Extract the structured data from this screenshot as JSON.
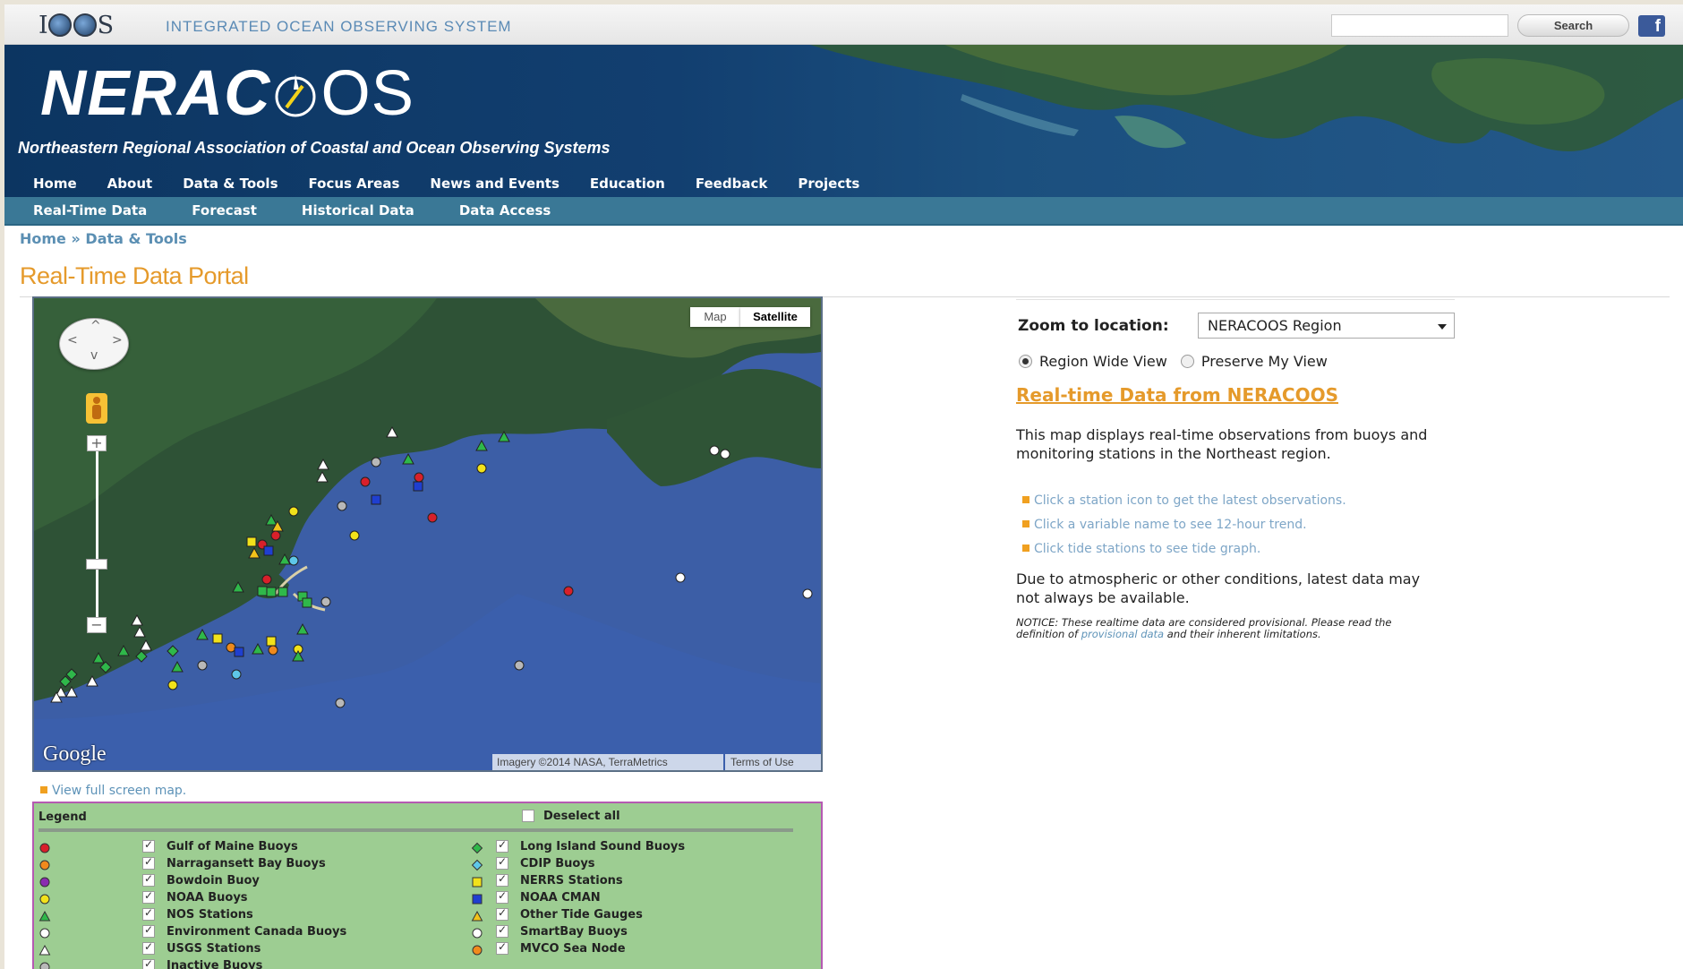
{
  "ioos": {
    "logo_text": "IOOS",
    "name": "Integrated Ocean Observing System",
    "search_value": "",
    "search_button": "Search",
    "facebook_glyph": "f"
  },
  "banner": {
    "title_bold": "NERAC",
    "title_thin": "OS",
    "subtitle": "Northeastern Regional Association of Coastal and Ocean Observing Systems"
  },
  "nav_primary": [
    "Home",
    "About",
    "Data & Tools",
    "Focus Areas",
    "News and Events",
    "Education",
    "Feedback",
    "Projects"
  ],
  "nav_secondary": [
    "Real-Time Data",
    "Forecast",
    "Historical Data",
    "Data Access"
  ],
  "breadcrumb": {
    "home": "Home",
    "separator": "»",
    "current": "Data & Tools"
  },
  "page_title": "Real-Time Data Portal",
  "map": {
    "type_map": "Map",
    "type_satellite": "Satellite",
    "selected_type": "Satellite",
    "zoom_in": "+",
    "zoom_out": "−",
    "google": "Google",
    "imagery": "Imagery ©2014 NASA, TerraMetrics",
    "terms": "Terms of Use",
    "full_screen": "View full screen map."
  },
  "legend": {
    "header": "Legend",
    "deselect_all": "Deselect all",
    "left": [
      {
        "label": "Gulf of Maine Buoys",
        "symbol": "circle",
        "color": "#d8202a",
        "checked": true
      },
      {
        "label": "Narragansett Bay Buoys",
        "symbol": "circle",
        "color": "#f08a1c",
        "checked": true
      },
      {
        "label": "Bowdoin Buoy",
        "symbol": "circle",
        "color": "#8a2bb0",
        "checked": true
      },
      {
        "label": "NOAA Buoys",
        "symbol": "circle",
        "color": "#f2e21a",
        "checked": true
      },
      {
        "label": "NOS Stations",
        "symbol": "triangle",
        "color": "#2fb84a",
        "checked": true
      },
      {
        "label": "Environment Canada Buoys",
        "symbol": "circle",
        "color": "#ffffff",
        "checked": true
      },
      {
        "label": "USGS Stations",
        "symbol": "triangle",
        "color": "#ffffff",
        "checked": true
      },
      {
        "label": "Inactive Buoys",
        "symbol": "circle",
        "color": "#b8b8b8",
        "checked": true
      }
    ],
    "right": [
      {
        "label": "Long Island Sound Buoys",
        "symbol": "diamond",
        "color": "#2fb84a",
        "checked": true
      },
      {
        "label": "CDIP Buoys",
        "symbol": "diamond",
        "color": "#5ec7e8",
        "checked": true
      },
      {
        "label": "NERRS Stations",
        "symbol": "square",
        "color": "#f2e21a",
        "checked": true
      },
      {
        "label": "NOAA CMAN",
        "symbol": "square",
        "color": "#1f3fd0",
        "checked": true
      },
      {
        "label": "Other Tide Gauges",
        "symbol": "triangle",
        "color": "#f2c21a",
        "checked": true
      },
      {
        "label": "SmartBay Buoys",
        "symbol": "circle",
        "color": "#ffffff",
        "checked": true
      },
      {
        "label": "MVCO Sea Node",
        "symbol": "circle",
        "color": "#f08a1c",
        "checked": true
      }
    ]
  },
  "panel": {
    "zoom_label": "Zoom to location:",
    "zoom_value": "NERACOOS Region",
    "radio_region": "Region Wide View",
    "radio_preserve": "Preserve My View",
    "radio_selected": "Region Wide View",
    "heading": "Real-time Data from NERACOOS",
    "description": "This map displays real-time observations from buoys and monitoring stations in the Northeast region.",
    "tips": [
      "Click a station icon to get the latest observations.",
      "Click a variable name to see 12-hour trend.",
      "Click tide stations to see tide graph."
    ],
    "note": "Due to atmospheric or other conditions, latest data may not always be available.",
    "notice_start": "NOTICE: These realtime data are considered provisional. Please read the definition of",
    "notice_link": "provisional data",
    "notice_end": "and their inherent limitations."
  }
}
